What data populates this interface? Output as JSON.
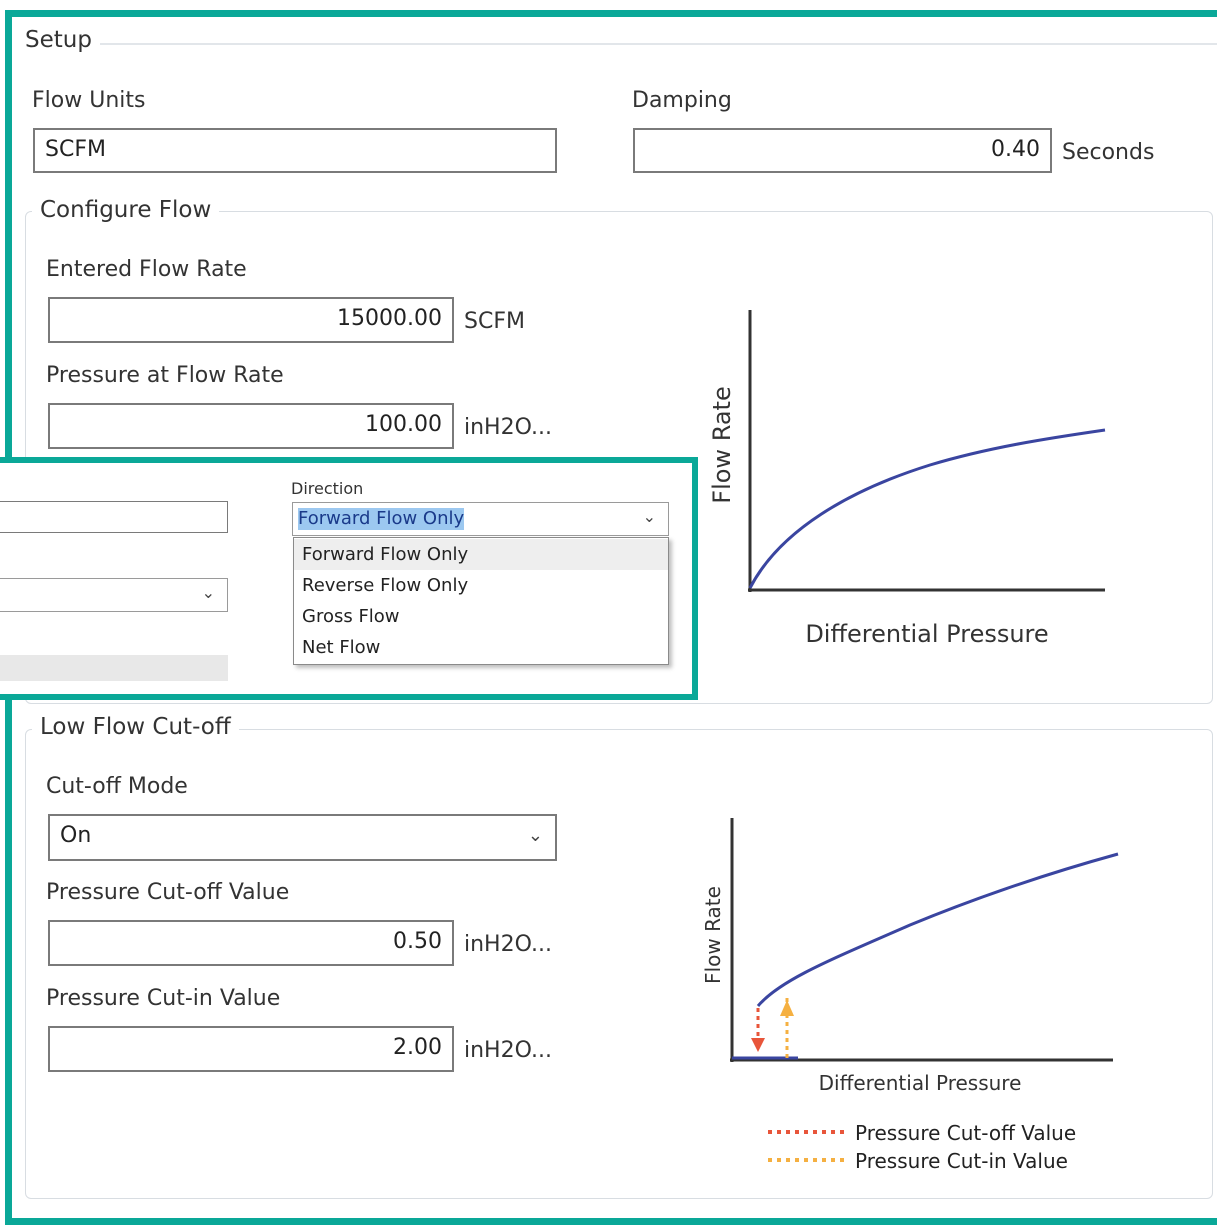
{
  "setup": {
    "title": "Setup",
    "flow_units_label": "Flow Units",
    "flow_units_value": "SCFM",
    "damping_label": "Damping",
    "damping_value": "0.40",
    "damping_unit": "Seconds"
  },
  "configure_flow": {
    "title": "Configure Flow",
    "entered_flow_rate_label": "Entered Flow Rate",
    "entered_flow_rate_value": "15000.00",
    "entered_flow_rate_unit": "SCFM",
    "pressure_label": "Pressure at Flow Rate",
    "pressure_value": "100.00",
    "pressure_unit": "inH2O...",
    "chart": {
      "ylabel": "Flow Rate",
      "xlabel": "Differential Pressure"
    }
  },
  "direction": {
    "label": "Direction",
    "selected": "Forward Flow Only",
    "options": [
      "Forward Flow Only",
      "Reverse Flow Only",
      "Gross Flow",
      "Net Flow"
    ],
    "hovered_index": 0
  },
  "low_flow_cutoff": {
    "title": "Low Flow Cut-off",
    "mode_label": "Cut-off Mode",
    "mode_value": "On",
    "cutoff_label": "Pressure Cut-off Value",
    "cutoff_value": "0.50",
    "cutoff_unit": "inH2O...",
    "cutin_label": "Pressure Cut-in Value",
    "cutin_value": "2.00",
    "cutin_unit": "inH2O...",
    "chart": {
      "ylabel": "Flow Rate",
      "xlabel": "Differential Pressure",
      "legend_cutoff": "Pressure Cut-off Value",
      "legend_cutin": "Pressure Cut-in Value"
    }
  },
  "colors": {
    "frame": "#0aa898",
    "curve": "#3a45a0",
    "cutoff": "#e8553a",
    "cutin": "#f5b041",
    "selection": "#9cc8f0"
  },
  "icons": {
    "dropdown": "chevron-down-icon"
  }
}
